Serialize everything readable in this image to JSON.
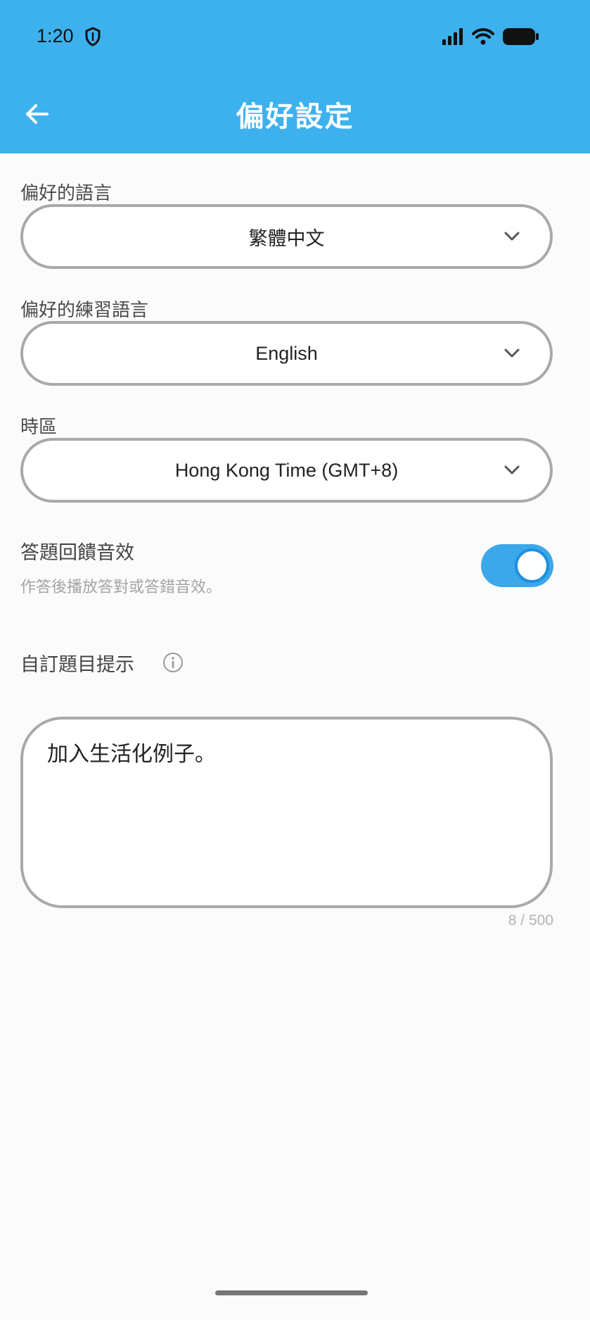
{
  "status_bar": {
    "time": "1:20"
  },
  "app_bar": {
    "title": "偏好設定"
  },
  "form": {
    "language": {
      "label": "偏好的語言",
      "value": "繁體中文"
    },
    "practice_language": {
      "label": "偏好的練習語言",
      "value": "English"
    },
    "timezone": {
      "label": "時區",
      "value": "Hong Kong Time (GMT+8)"
    },
    "sound_feedback": {
      "title": "答題回饋音效",
      "description": "作答後播放答對或答錯音效。",
      "enabled": true
    },
    "custom_hint": {
      "title": "自訂題目提示",
      "value": "加入生活化例子。",
      "counter": "8 / 500"
    }
  },
  "colors": {
    "header": "#3db1ee",
    "toggle_on": "#3aa8ea"
  },
  "icons": [
    "shield-icon",
    "signal-icon",
    "wifi-icon",
    "battery-icon",
    "back-arrow-icon",
    "chevron-down-icon",
    "info-icon"
  ]
}
